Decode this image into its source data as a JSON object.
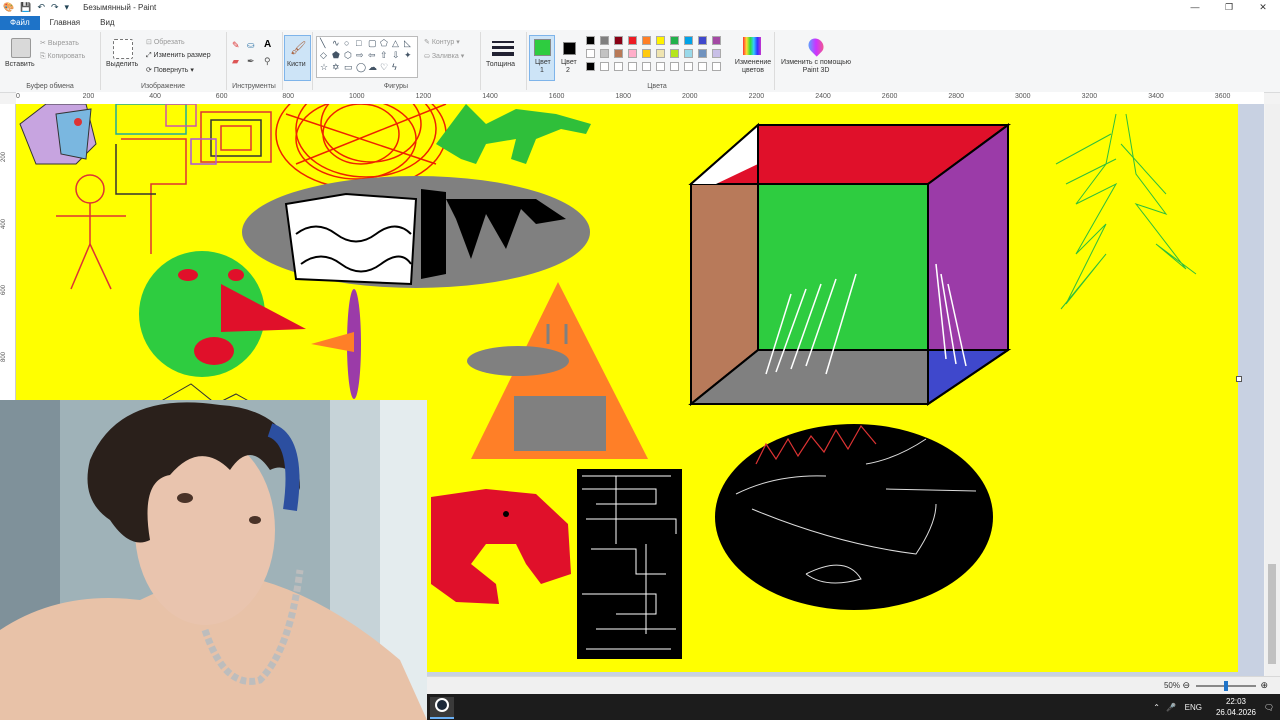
{
  "window": {
    "title": "Безымянный - Paint",
    "controls": [
      "—",
      "❐",
      "✕"
    ]
  },
  "tabs": [
    "Файл",
    "Главная",
    "Вид"
  ],
  "ribbon": {
    "clipboard": {
      "paste": "Вставить",
      "cut": "Вырезать",
      "copy": "Копировать",
      "label": "Буфер обмена"
    },
    "image": {
      "select": "Выделить",
      "crop": "Обрезать",
      "resize": "Изменить размер",
      "rotate": "Повернуть ▾",
      "label": "Изображение"
    },
    "tools": {
      "label": "Инструменты",
      "text_tool": "A"
    },
    "brushes": {
      "label": "Кисти"
    },
    "shapes": {
      "label": "Фигуры",
      "outline": "Контур ▾",
      "fill": "Заливка ▾"
    },
    "size": {
      "label": "Толщина"
    },
    "color1": {
      "label": "Цвет 1",
      "value": "#2ecc40"
    },
    "color2": {
      "label": "Цвет 2",
      "value": "#000000"
    },
    "palette": {
      "label": "Цвета",
      "row1": [
        "#000000",
        "#7f7f7f",
        "#880015",
        "#ed1c24",
        "#ff7f27",
        "#fff200",
        "#22b14c",
        "#00a2e8",
        "#3f48cc",
        "#a349a4"
      ],
      "row2": [
        "#ffffff",
        "#c3c3c3",
        "#b97a57",
        "#ffaec9",
        "#ffc90e",
        "#efe4b0",
        "#b5e61d",
        "#99d9ea",
        "#7092be",
        "#c8bfe7"
      ],
      "row3": [
        "#000000",
        "#ffffff",
        "#ffffff",
        "#ffffff",
        "#ffffff",
        "#ffffff",
        "#ffffff",
        "#ffffff",
        "#ffffff",
        "#ffffff"
      ]
    },
    "edit_colors": "Изменение цветов",
    "paint3d": "Изменить с помощью Paint 3D"
  },
  "ruler": {
    "h_ticks": [
      "0",
      "200",
      "400",
      "600",
      "800",
      "1000",
      "1200",
      "1400",
      "1600",
      "1800",
      "2000",
      "2200",
      "2400",
      "2600",
      "2800",
      "3000",
      "3200",
      "3400",
      "3600"
    ],
    "v_ticks": [
      "200",
      "400",
      "600",
      "800"
    ]
  },
  "status": {
    "zoom": "50%",
    "zoom_fraction": 0.5,
    "minus": "⊖",
    "plus": "⊕"
  },
  "taskbar": {
    "lang": "ENG",
    "time": "22:03",
    "date": "26.04.2026"
  }
}
